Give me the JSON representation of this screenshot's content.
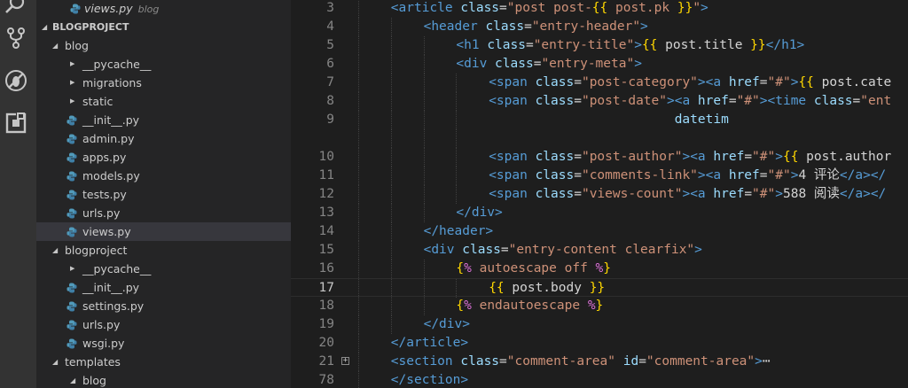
{
  "explorer": {
    "section_title": "BLOGPROJECT",
    "top_item": {
      "label": "views.py",
      "hint": "blog"
    },
    "items": [
      {
        "type": "folder",
        "label": "blog",
        "open": true
      },
      {
        "type": "folder",
        "label": "__pycache__",
        "open": false
      },
      {
        "type": "folder",
        "label": "migrations",
        "open": false
      },
      {
        "type": "folder",
        "label": "static",
        "open": false
      },
      {
        "type": "file",
        "label": "__init__.py"
      },
      {
        "type": "file",
        "label": "admin.py"
      },
      {
        "type": "file",
        "label": "apps.py"
      },
      {
        "type": "file",
        "label": "models.py"
      },
      {
        "type": "file",
        "label": "tests.py"
      },
      {
        "type": "file",
        "label": "urls.py"
      },
      {
        "type": "file",
        "label": "views.py",
        "selected": true
      },
      {
        "type": "folder",
        "label": "blogproject",
        "open": true
      },
      {
        "type": "folder",
        "label": "__pycache__",
        "open": false
      },
      {
        "type": "file",
        "label": "__init__.py"
      },
      {
        "type": "file",
        "label": "settings.py"
      },
      {
        "type": "file",
        "label": "urls.py"
      },
      {
        "type": "file",
        "label": "wsgi.py"
      },
      {
        "type": "folder",
        "label": "templates",
        "open": true
      },
      {
        "type": "folder",
        "label": "blog",
        "open": true
      }
    ]
  },
  "activity_icons": [
    "search-icon",
    "source-control-icon",
    "debug-icon",
    "extensions-icon"
  ],
  "editor": {
    "active_line": "17",
    "lines": [
      {
        "num": "3",
        "indent": 1,
        "tokens": [
          [
            "t",
            "<article "
          ],
          [
            "a",
            "class"
          ],
          [
            "e",
            "="
          ],
          [
            "s",
            "\"post post-"
          ],
          [
            "d",
            "{{"
          ],
          [
            "s",
            " post.pk "
          ],
          [
            "d",
            "}}"
          ],
          [
            "s",
            "\""
          ],
          [
            "t",
            ">"
          ]
        ]
      },
      {
        "num": "4",
        "indent": 2,
        "tokens": [
          [
            "t",
            "<header "
          ],
          [
            "a",
            "class"
          ],
          [
            "e",
            "="
          ],
          [
            "s",
            "\"entry-header\""
          ],
          [
            "t",
            ">"
          ]
        ]
      },
      {
        "num": "5",
        "indent": 3,
        "tokens": [
          [
            "t",
            "<h1 "
          ],
          [
            "a",
            "class"
          ],
          [
            "e",
            "="
          ],
          [
            "s",
            "\"entry-title\""
          ],
          [
            "t",
            ">"
          ],
          [
            "d",
            "{{"
          ],
          [
            "e",
            " post.title "
          ],
          [
            "d",
            "}}"
          ],
          [
            "t",
            "</h1>"
          ]
        ]
      },
      {
        "num": "6",
        "indent": 3,
        "tokens": [
          [
            "t",
            "<div "
          ],
          [
            "a",
            "class"
          ],
          [
            "e",
            "="
          ],
          [
            "s",
            "\"entry-meta\""
          ],
          [
            "t",
            ">"
          ]
        ]
      },
      {
        "num": "7",
        "indent": 4,
        "tokens": [
          [
            "t",
            "<span "
          ],
          [
            "a",
            "class"
          ],
          [
            "e",
            "="
          ],
          [
            "s",
            "\"post-category\""
          ],
          [
            "t",
            "><a "
          ],
          [
            "a",
            "href"
          ],
          [
            "e",
            "="
          ],
          [
            "s",
            "\"#\""
          ],
          [
            "t",
            ">"
          ],
          [
            "d",
            "{{"
          ],
          [
            "e",
            " post.cate"
          ]
        ]
      },
      {
        "num": "8",
        "indent": 4,
        "tokens": [
          [
            "t",
            "<span "
          ],
          [
            "a",
            "class"
          ],
          [
            "e",
            "="
          ],
          [
            "s",
            "\"post-date\""
          ],
          [
            "t",
            "><a "
          ],
          [
            "a",
            "href"
          ],
          [
            "e",
            "="
          ],
          [
            "s",
            "\"#\""
          ],
          [
            "t",
            "><time "
          ],
          [
            "a",
            "class"
          ],
          [
            "e",
            "="
          ],
          [
            "s",
            "\"ent"
          ]
        ]
      },
      {
        "num": "9",
        "indent": 4,
        "tokens": [
          [
            "a",
            "                        datetim"
          ]
        ]
      },
      {
        "num": "",
        "indent": 4,
        "tokens": []
      },
      {
        "num": "10",
        "indent": 4,
        "tokens": [
          [
            "t",
            "<span "
          ],
          [
            "a",
            "class"
          ],
          [
            "e",
            "="
          ],
          [
            "s",
            "\"post-author\""
          ],
          [
            "t",
            "><a "
          ],
          [
            "a",
            "href"
          ],
          [
            "e",
            "="
          ],
          [
            "s",
            "\"#\""
          ],
          [
            "t",
            ">"
          ],
          [
            "d",
            "{{"
          ],
          [
            "e",
            " post.author"
          ]
        ]
      },
      {
        "num": "11",
        "indent": 4,
        "tokens": [
          [
            "t",
            "<span "
          ],
          [
            "a",
            "class"
          ],
          [
            "e",
            "="
          ],
          [
            "s",
            "\"comments-link\""
          ],
          [
            "t",
            "><a "
          ],
          [
            "a",
            "href"
          ],
          [
            "e",
            "="
          ],
          [
            "s",
            "\"#\""
          ],
          [
            "t",
            ">"
          ],
          [
            "e",
            "4 评论"
          ],
          [
            "t",
            "</a></"
          ]
        ]
      },
      {
        "num": "12",
        "indent": 4,
        "tokens": [
          [
            "t",
            "<span "
          ],
          [
            "a",
            "class"
          ],
          [
            "e",
            "="
          ],
          [
            "s",
            "\"views-count\""
          ],
          [
            "t",
            "><a "
          ],
          [
            "a",
            "href"
          ],
          [
            "e",
            "="
          ],
          [
            "s",
            "\"#\""
          ],
          [
            "t",
            ">"
          ],
          [
            "e",
            "588 阅读"
          ],
          [
            "t",
            "</a></"
          ]
        ]
      },
      {
        "num": "13",
        "indent": 3,
        "tokens": [
          [
            "t",
            "</div>"
          ]
        ]
      },
      {
        "num": "14",
        "indent": 2,
        "tokens": [
          [
            "t",
            "</header>"
          ]
        ]
      },
      {
        "num": "15",
        "indent": 2,
        "tokens": [
          [
            "t",
            "<div "
          ],
          [
            "a",
            "class"
          ],
          [
            "e",
            "="
          ],
          [
            "s",
            "\"entry-content clearfix\""
          ],
          [
            "t",
            ">"
          ]
        ]
      },
      {
        "num": "16",
        "indent": 3,
        "tokens": [
          [
            "d",
            "{"
          ],
          [
            "m",
            "%"
          ],
          [
            "s",
            " autoescape off "
          ],
          [
            "m",
            "%"
          ],
          [
            "d",
            "}"
          ]
        ]
      },
      {
        "num": "17",
        "indent": 4,
        "tokens": [
          [
            "d",
            "{{"
          ],
          [
            "e",
            " post.body "
          ],
          [
            "d",
            "}}"
          ]
        ]
      },
      {
        "num": "18",
        "indent": 3,
        "tokens": [
          [
            "d",
            "{"
          ],
          [
            "m",
            "%"
          ],
          [
            "s",
            " endautoescape "
          ],
          [
            "m",
            "%"
          ],
          [
            "d",
            "}"
          ]
        ]
      },
      {
        "num": "19",
        "indent": 2,
        "tokens": [
          [
            "t",
            "</div>"
          ]
        ]
      },
      {
        "num": "20",
        "indent": 1,
        "tokens": [
          [
            "t",
            "</article>"
          ]
        ]
      },
      {
        "num": "21",
        "indent": 1,
        "fold": "+",
        "tokens": [
          [
            "t",
            "<section "
          ],
          [
            "a",
            "class"
          ],
          [
            "e",
            "="
          ],
          [
            "s",
            "\"comment-area\""
          ],
          [
            "e",
            " "
          ],
          [
            "a",
            "id"
          ],
          [
            "e",
            "="
          ],
          [
            "s",
            "\"comment-area\""
          ],
          [
            "t",
            ">"
          ],
          [
            "e",
            "⋯"
          ]
        ]
      },
      {
        "num": "78",
        "indent": 1,
        "tokens": [
          [
            "t",
            "</section>"
          ]
        ]
      }
    ]
  },
  "colors": {
    "activity_bar": "#333333",
    "sidebar": "#252526",
    "editor_bg": "#1e1e1e",
    "selected_row": "#37373d",
    "tag": "#569cd6",
    "attribute": "#9cdcfe",
    "string": "#ce9178",
    "template_brace": "#ffd700",
    "template_percent": "#da70d6"
  }
}
